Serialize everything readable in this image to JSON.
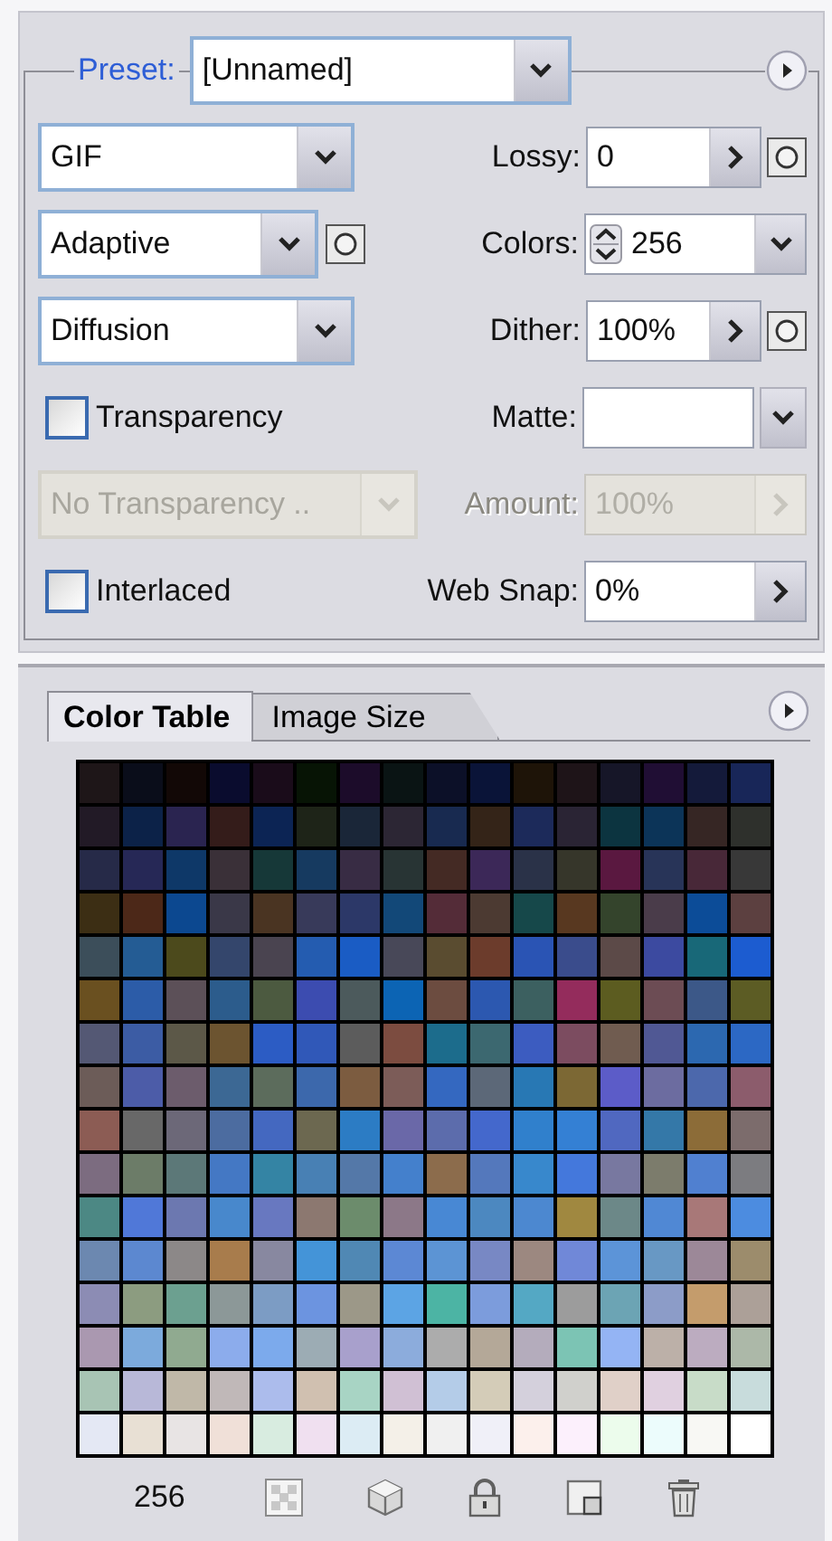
{
  "preset": {
    "label": "Preset:",
    "value": "[Unnamed]"
  },
  "left_controls": [
    {
      "kind": "dropdown",
      "value": "GIF",
      "disabled": false
    },
    {
      "kind": "dropdown",
      "value": "Adaptive",
      "disabled": false,
      "mask_button": true
    },
    {
      "kind": "dropdown",
      "value": "Diffusion",
      "disabled": false
    },
    {
      "kind": "checkbox",
      "label": "Transparency",
      "checked": false
    },
    {
      "kind": "dropdown",
      "value": "No Transparency ..",
      "disabled": true
    },
    {
      "kind": "checkbox",
      "label": "Interlaced",
      "checked": false
    }
  ],
  "right_controls": [
    {
      "kind": "stepper",
      "label": "Lossy:",
      "value": "0",
      "disabled": false,
      "mask_button": true
    },
    {
      "kind": "spin_dropdown",
      "label": "Colors:",
      "value": "256",
      "disabled": false
    },
    {
      "kind": "stepper",
      "label": "Dither:",
      "value": "100%",
      "disabled": false,
      "mask_button": true
    },
    {
      "kind": "dropdown",
      "label": "Matte:",
      "disabled": false
    },
    {
      "kind": "stepper",
      "label": "Amount:",
      "value": "100%",
      "disabled": true
    },
    {
      "kind": "stepper",
      "label": "Web Snap:",
      "value": "0%",
      "disabled": false
    }
  ],
  "tabs": [
    {
      "label": "Color Table",
      "selected": true
    },
    {
      "label": "Image Size",
      "selected": false
    }
  ],
  "color_table": {
    "rows": [
      {
        "swatches": [
          {
            "color": "#1e1618"
          },
          {
            "color": "#0a0d1a"
          },
          {
            "color": "#120806"
          },
          {
            "color": "#0a0c2e"
          },
          {
            "color": "#1a0c1a"
          },
          {
            "color": "#071405"
          },
          {
            "color": "#1c0c2a"
          },
          {
            "color": "#0a1414"
          },
          {
            "color": "#0c1028"
          },
          {
            "color": "#0a1438"
          },
          {
            "color": "#1e1408"
          },
          {
            "color": "#1e1418"
          },
          {
            "color": "#161628"
          },
          {
            "color": "#200e34"
          },
          {
            "color": "#141a3a"
          },
          {
            "color": "#182658"
          }
        ]
      },
      {
        "swatches": [
          {
            "color": "#221a26"
          },
          {
            "color": "#0c2248"
          },
          {
            "color": "#2a2450"
          },
          {
            "color": "#341c1a"
          },
          {
            "color": "#0c2454"
          },
          {
            "color": "#1e2418"
          },
          {
            "color": "#1a2638"
          },
          {
            "color": "#2c2634"
          },
          {
            "color": "#182a50"
          },
          {
            "color": "#342418"
          },
          {
            "color": "#1c2a5a"
          },
          {
            "color": "#2a2434"
          },
          {
            "color": "#0c3440"
          },
          {
            "color": "#0c3458"
          },
          {
            "color": "#362624"
          },
          {
            "color": "#2e302c"
          }
        ]
      },
      {
        "swatches": [
          {
            "color": "#262a48"
          },
          {
            "color": "#262856"
          },
          {
            "color": "#0e3868"
          },
          {
            "color": "#3a3038"
          },
          {
            "color": "#163838"
          },
          {
            "color": "#163a60"
          },
          {
            "color": "#382c44"
          },
          {
            "color": "#283434"
          },
          {
            "color": "#442a24"
          },
          {
            "color": "#3c2858"
          },
          {
            "color": "#2a3248"
          },
          {
            "color": "#36362a"
          },
          {
            "color": "#5a1840"
          },
          {
            "color": "#283458"
          },
          {
            "color": "#482838"
          },
          {
            "color": "#383838"
          }
        ]
      },
      {
        "swatches": [
          {
            "color": "#3c2e14"
          },
          {
            "color": "#4c2818"
          },
          {
            "color": "#0c4890"
          },
          {
            "color": "#3a3848"
          },
          {
            "color": "#4a3422"
          },
          {
            "color": "#383a5a"
          },
          {
            "color": "#2c3868"
          },
          {
            "color": "#124878"
          },
          {
            "color": "#542c38"
          },
          {
            "color": "#4c3a32"
          },
          {
            "color": "#16484a"
          },
          {
            "color": "#583820"
          },
          {
            "color": "#34442c"
          },
          {
            "color": "#4a3c4a"
          },
          {
            "color": "#0c4c98"
          },
          {
            "color": "#5c4040"
          }
        ]
      },
      {
        "swatches": [
          {
            "color": "#3c4e5a"
          },
          {
            "color": "#245c94"
          },
          {
            "color": "#4c4a1c"
          },
          {
            "color": "#34466c"
          },
          {
            "color": "#4a4450"
          },
          {
            "color": "#245cb0"
          },
          {
            "color": "#1a5cc4"
          },
          {
            "color": "#484858"
          },
          {
            "color": "#5a4c30"
          },
          {
            "color": "#6c3c2c"
          },
          {
            "color": "#2a54b4"
          },
          {
            "color": "#3a4c8c"
          },
          {
            "color": "#5c4a48"
          },
          {
            "color": "#3c4aa0"
          },
          {
            "color": "#186878"
          },
          {
            "color": "#1c5cd0"
          }
        ]
      },
      {
        "swatches": [
          {
            "color": "#6a5020"
          },
          {
            "color": "#2c5ca8"
          },
          {
            "color": "#5c5058"
          },
          {
            "color": "#2c5c8c"
          },
          {
            "color": "#4c5a40"
          },
          {
            "color": "#3c4cb0"
          },
          {
            "color": "#4c5a5c"
          },
          {
            "color": "#0c64b4"
          },
          {
            "color": "#6c4c40"
          },
          {
            "color": "#2c58b0"
          },
          {
            "color": "#3c6060"
          },
          {
            "color": "#942c5c"
          },
          {
            "color": "#5c5c20"
          },
          {
            "color": "#6c4c54"
          },
          {
            "color": "#3c5888"
          },
          {
            "color": "#5c5c24"
          }
        ]
      },
      {
        "swatches": [
          {
            "color": "#545874"
          },
          {
            "color": "#3c5ca4"
          },
          {
            "color": "#5c5848"
          },
          {
            "color": "#6c5430"
          },
          {
            "color": "#2c5cc4"
          },
          {
            "color": "#3058b8"
          },
          {
            "color": "#5c5c5c"
          },
          {
            "color": "#7c4c40"
          },
          {
            "color": "#1c6c8c"
          },
          {
            "color": "#3c6870"
          },
          {
            "color": "#3c5cc0"
          },
          {
            "color": "#7c4c60"
          },
          {
            "color": "#705c50"
          },
          {
            "color": "#505894"
          },
          {
            "color": "#2c68b0"
          },
          {
            "color": "#2c68c4"
          }
        ]
      },
      {
        "swatches": [
          {
            "color": "#6c5c58"
          },
          {
            "color": "#4c5ca8"
          },
          {
            "color": "#6c5c6c"
          },
          {
            "color": "#3c6894"
          },
          {
            "color": "#5c6c5c"
          },
          {
            "color": "#3c68ac"
          },
          {
            "color": "#7c5c40"
          },
          {
            "color": "#7c5c58"
          },
          {
            "color": "#3468c0"
          },
          {
            "color": "#5c6878"
          },
          {
            "color": "#2878b4"
          },
          {
            "color": "#7c6834"
          },
          {
            "color": "#5c5cc8"
          },
          {
            "color": "#6c6ca0"
          },
          {
            "color": "#4c68ac"
          },
          {
            "color": "#8c5c6c"
          }
        ]
      },
      {
        "swatches": [
          {
            "color": "#8c5c54"
          },
          {
            "color": "#686868"
          },
          {
            "color": "#6c6878"
          },
          {
            "color": "#4c6ca0"
          },
          {
            "color": "#4468c0"
          },
          {
            "color": "#6c6850"
          },
          {
            "color": "#2c7cc4"
          },
          {
            "color": "#6a68a8"
          },
          {
            "color": "#5c6cac"
          },
          {
            "color": "#4468cc"
          },
          {
            "color": "#3080cc"
          },
          {
            "color": "#3480d4"
          },
          {
            "color": "#5068c0"
          },
          {
            "color": "#3478a8"
          },
          {
            "color": "#8c6c38"
          },
          {
            "color": "#7c6c6c"
          }
        ]
      },
      {
        "swatches": [
          {
            "color": "#7c6c80"
          },
          {
            "color": "#6c7c68"
          },
          {
            "color": "#5c7878"
          },
          {
            "color": "#4478c4"
          },
          {
            "color": "#3484a4"
          },
          {
            "color": "#4880b4"
          },
          {
            "color": "#5478a8"
          },
          {
            "color": "#4480cc"
          },
          {
            "color": "#8c6c4c"
          },
          {
            "color": "#5478bc"
          },
          {
            "color": "#3888cc"
          },
          {
            "color": "#4478dc"
          },
          {
            "color": "#7878a0"
          },
          {
            "color": "#7c7c6c"
          },
          {
            "color": "#5080d0"
          },
          {
            "color": "#7c7c80"
          }
        ]
      },
      {
        "swatches": [
          {
            "color": "#4c8884"
          },
          {
            "color": "#5078d8"
          },
          {
            "color": "#6c78b0"
          },
          {
            "color": "#4888cc"
          },
          {
            "color": "#6878c0"
          },
          {
            "color": "#8c7870"
          },
          {
            "color": "#6c8c6c"
          },
          {
            "color": "#8c7888"
          },
          {
            "color": "#4888d4"
          },
          {
            "color": "#4c88c0"
          },
          {
            "color": "#4c88d0"
          },
          {
            "color": "#a08840"
          },
          {
            "color": "#6c8888"
          },
          {
            "color": "#5088d4"
          },
          {
            "color": "#a87878"
          },
          {
            "color": "#4c8ce0"
          }
        ]
      },
      {
        "swatches": [
          {
            "color": "#6c88b0"
          },
          {
            "color": "#5c88d0"
          },
          {
            "color": "#8c8888"
          },
          {
            "color": "#a87c4c"
          },
          {
            "color": "#8888a0"
          },
          {
            "color": "#4494d8"
          },
          {
            "color": "#5088b4"
          },
          {
            "color": "#5c88d4"
          },
          {
            "color": "#5c94d4"
          },
          {
            "color": "#7888c4"
          },
          {
            "color": "#9c8880"
          },
          {
            "color": "#7088d8"
          },
          {
            "color": "#5c94d8"
          },
          {
            "color": "#6898c4"
          },
          {
            "color": "#9c8898"
          },
          {
            "color": "#9c8c6c"
          }
        ]
      },
      {
        "swatches": [
          {
            "color": "#8c8cb4"
          },
          {
            "color": "#8c9c80"
          },
          {
            "color": "#6ca090"
          },
          {
            "color": "#8c9898"
          },
          {
            "color": "#7c9cc4"
          },
          {
            "color": "#6c94e0"
          },
          {
            "color": "#9c9888"
          },
          {
            "color": "#5ca4e4"
          },
          {
            "color": "#4cb4a4"
          },
          {
            "color": "#7c9cdc"
          },
          {
            "color": "#54a8c4"
          },
          {
            "color": "#9c9c9c"
          },
          {
            "color": "#6ca4b4"
          },
          {
            "color": "#8c9cc8"
          },
          {
            "color": "#c49c6c"
          },
          {
            "color": "#aca098"
          }
        ]
      },
      {
        "swatches": [
          {
            "color": "#aa98b0"
          },
          {
            "color": "#7caadc"
          },
          {
            "color": "#90aa90"
          },
          {
            "color": "#8cacec"
          },
          {
            "color": "#7caaec"
          },
          {
            "color": "#9cacb4"
          },
          {
            "color": "#a8a0cc"
          },
          {
            "color": "#8cacdc"
          },
          {
            "color": "#acacac"
          },
          {
            "color": "#b4a898"
          },
          {
            "color": "#b4acbc"
          },
          {
            "color": "#7cc4b4"
          },
          {
            "color": "#94b4f4"
          },
          {
            "color": "#bcb0a8"
          },
          {
            "color": "#bcacc0"
          },
          {
            "color": "#acb8a8"
          }
        ]
      },
      {
        "swatches": [
          {
            "color": "#a8c4b4"
          },
          {
            "color": "#b8b8d8"
          },
          {
            "color": "#c0b8a8"
          },
          {
            "color": "#c0b8b8"
          },
          {
            "color": "#acbcec"
          },
          {
            "color": "#d0c0b0"
          },
          {
            "color": "#a8d4c4"
          },
          {
            "color": "#d0c0d4"
          },
          {
            "color": "#b4cce8"
          },
          {
            "color": "#d4ccb8"
          },
          {
            "color": "#d4d0dc"
          },
          {
            "color": "#d0d0cc"
          },
          {
            "color": "#e0d0c8"
          },
          {
            "color": "#e0d0e0"
          },
          {
            "color": "#c8dcc8"
          },
          {
            "color": "#c8dcdc"
          }
        ]
      },
      {
        "swatches": [
          {
            "color": "#e4e8f4"
          },
          {
            "color": "#e8e0d4"
          },
          {
            "color": "#e8e4e4"
          },
          {
            "color": "#f0e0d8"
          },
          {
            "color": "#d8ece0"
          },
          {
            "color": "#f0e0f0"
          },
          {
            "color": "#dcecf4"
          },
          {
            "color": "#f4f0e8"
          },
          {
            "color": "#f0f0f0"
          },
          {
            "color": "#f0f0f8"
          },
          {
            "color": "#fcf0ec"
          },
          {
            "color": "#fcf0fc"
          },
          {
            "color": "#ecfcec"
          },
          {
            "color": "#ecfcfc"
          },
          {
            "color": "#f8f8f4"
          },
          {
            "color": "#ffffff"
          }
        ]
      }
    ]
  },
  "color_count": "256"
}
